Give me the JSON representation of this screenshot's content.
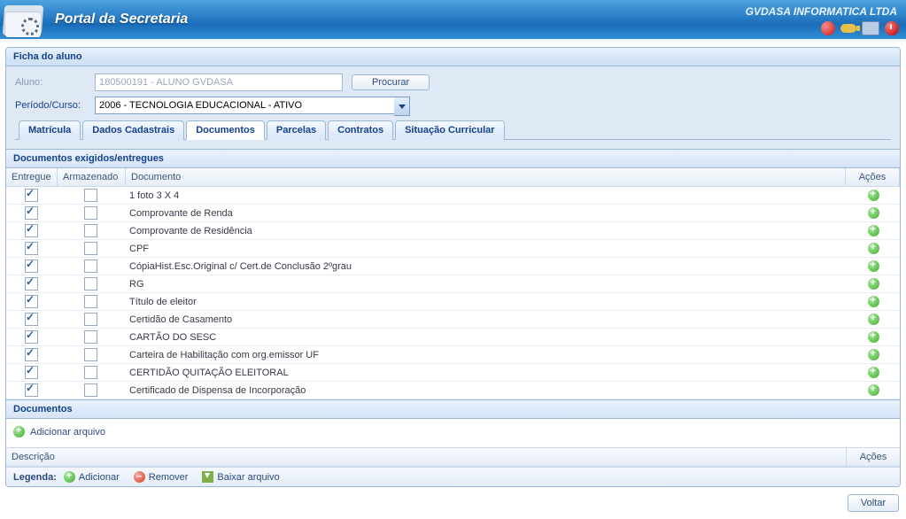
{
  "header": {
    "title": "Portal da Secretaria",
    "company": "GVDASA INFORMATICA LTDA"
  },
  "panel1_title": "Ficha do aluno",
  "form": {
    "aluno_label": "Aluno:",
    "aluno_value": "180500191 - ALUNO GVDASA",
    "procurar_label": "Procurar",
    "periodo_label": "Período/Curso:",
    "periodo_value": "2006 - TECNOLOGIA EDUCACIONAL - ATIVO"
  },
  "tabs": [
    {
      "label": "Matrícula"
    },
    {
      "label": "Dados Cadastrais"
    },
    {
      "label": "Documentos"
    },
    {
      "label": "Parcelas"
    },
    {
      "label": "Contratos"
    },
    {
      "label": "Situação Curricular"
    }
  ],
  "active_tab_index": 2,
  "docs_section_title": "Documentos exigidos/entregues",
  "grid_headers": {
    "entregue": "Entregue",
    "armazenado": "Armazenado",
    "documento": "Documento",
    "acoes": "Ações"
  },
  "grid_rows": [
    {
      "entregue": true,
      "armazenado": false,
      "documento": "1 foto 3 X 4"
    },
    {
      "entregue": true,
      "armazenado": false,
      "documento": "Comprovante de Renda"
    },
    {
      "entregue": true,
      "armazenado": false,
      "documento": "Comprovante de Residência"
    },
    {
      "entregue": true,
      "armazenado": false,
      "documento": "CPF"
    },
    {
      "entregue": true,
      "armazenado": false,
      "documento": "CópiaHist.Esc.Original c/ Cert.de Conclusão 2ºgrau"
    },
    {
      "entregue": true,
      "armazenado": false,
      "documento": "RG"
    },
    {
      "entregue": true,
      "armazenado": false,
      "documento": "Título de eleitor"
    },
    {
      "entregue": true,
      "armazenado": false,
      "documento": "Certidão de Casamento"
    },
    {
      "entregue": true,
      "armazenado": false,
      "documento": "CARTÃO DO SESC"
    },
    {
      "entregue": true,
      "armazenado": false,
      "documento": "Carteira de Habilitação com org.emissor UF"
    },
    {
      "entregue": true,
      "armazenado": false,
      "documento": "CERTIDÃO QUITAÇÃO ELEITORAL"
    },
    {
      "entregue": true,
      "armazenado": false,
      "documento": "Certificado de Dispensa de Incorporação"
    }
  ],
  "documentos_section_title": "Documentos",
  "adicionar_arquivo_label": "Adicionar arquivo",
  "desc_headers": {
    "descricao": "Descrição",
    "acoes": "Ações"
  },
  "legend": {
    "label": "Legenda:",
    "adicionar": "Adicionar",
    "remover": "Remover",
    "baixar": "Baixar arquivo"
  },
  "voltar_label": "Voltar"
}
